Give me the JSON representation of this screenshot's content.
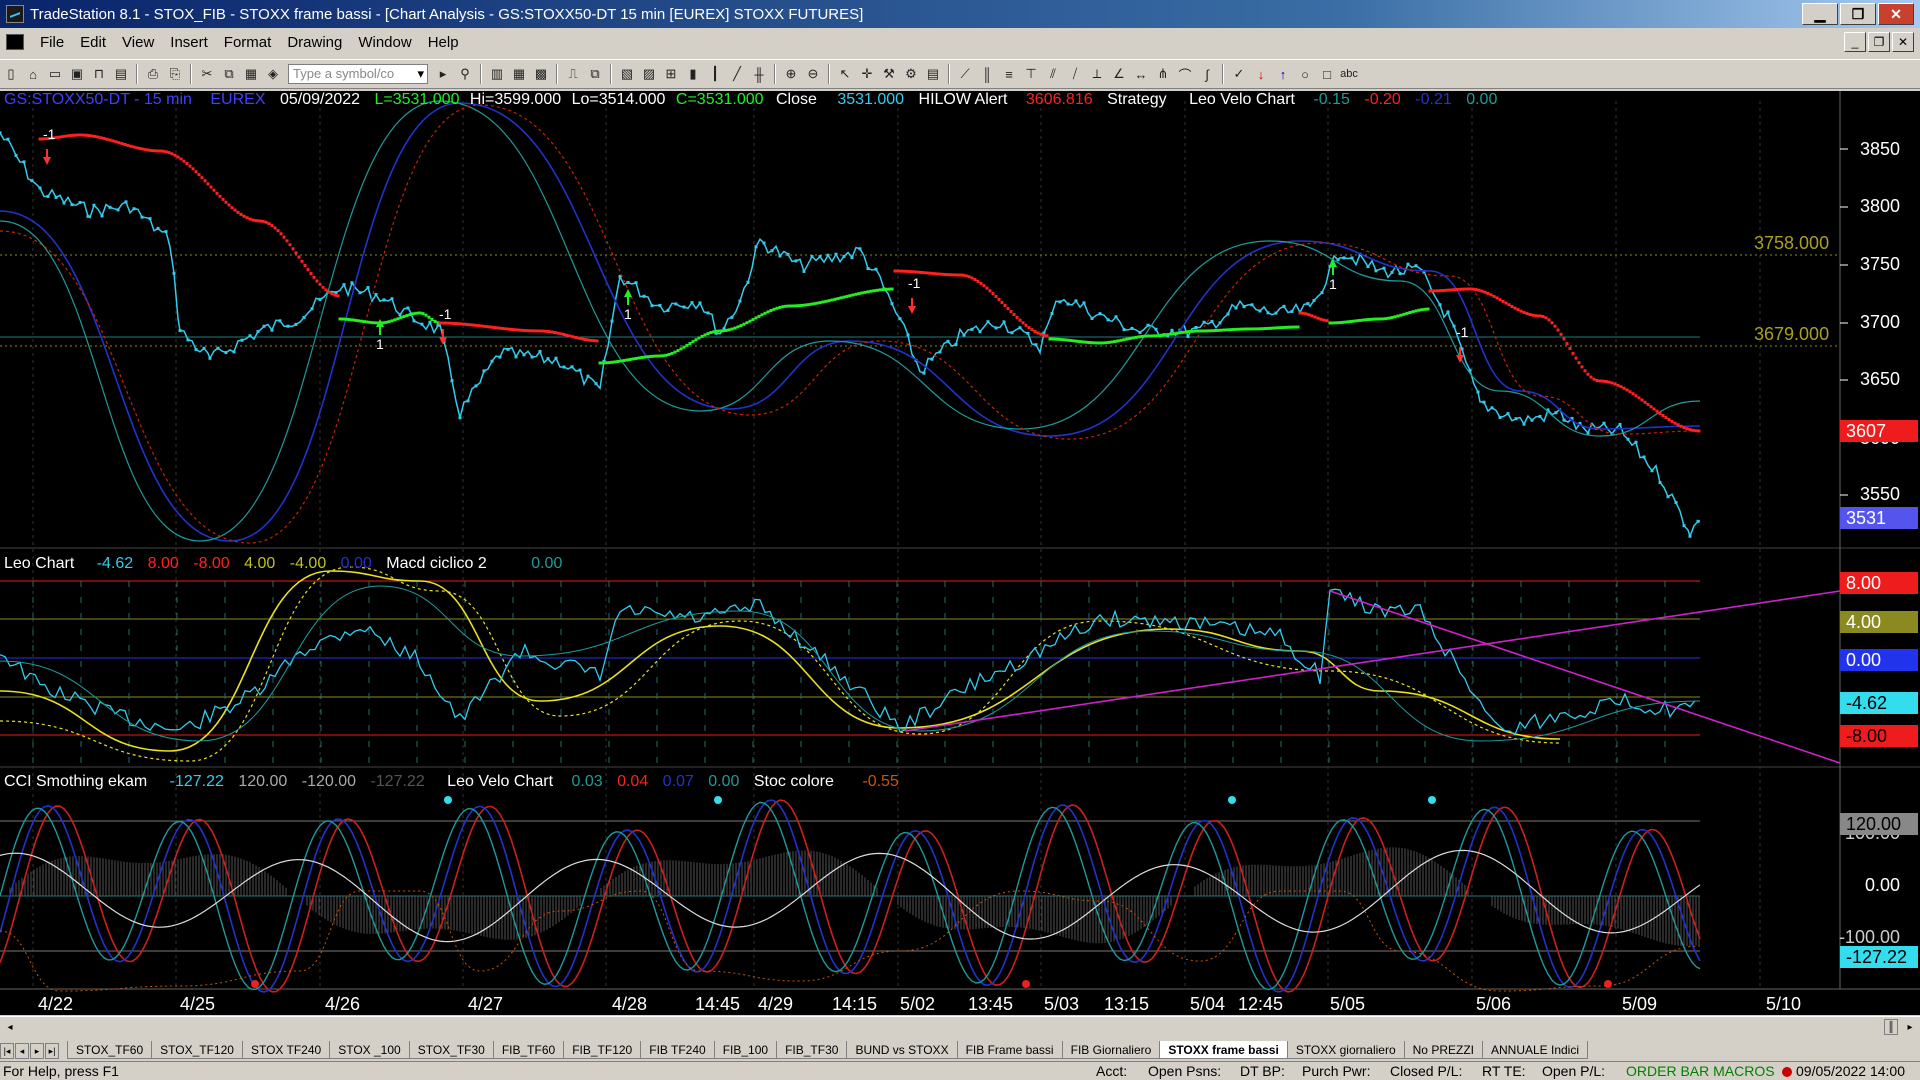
{
  "window": {
    "title": "TradeStation 8.1 - STOX_FIB - STOXX frame bassi - [Chart Analysis - GS:STOXX50-DT  15 min  [EUREX] STOXX FUTURES]"
  },
  "menu": [
    "File",
    "Edit",
    "View",
    "Insert",
    "Format",
    "Drawing",
    "Window",
    "Help"
  ],
  "toolbar": {
    "symbol_placeholder": "Type a symbol/co"
  },
  "price_header": {
    "symbol": "GS:STOXX50-DT - 15 min",
    "exchange": "EUREX",
    "date": "05/09/2022",
    "last": "L=3531.000",
    "hi": "Hi=3599.000",
    "lo": "Lo=3514.000",
    "close": "C=3531.000",
    "close_label": "Close",
    "close_value": "3531.000",
    "hilow_label": "HILOW Alert",
    "hilow_value": "3606.816",
    "strategy_label": "Strategy",
    "velo_label": "Leo Velo Chart",
    "velo_1": "-0.15",
    "velo_2": "-0.20",
    "velo_3": "-0.21",
    "velo_4": "0.00"
  },
  "leo_header": {
    "label": "Leo Chart",
    "v1": "-4.62",
    "v2": "8.00",
    "v3": "-8.00",
    "v4": "4.00",
    "v5": "-4.00",
    "v6": "0.00",
    "macd_label": "Macd ciclico 2",
    "macd_value": "0.00"
  },
  "cci_header": {
    "label": "CCI Smothing ekam",
    "v1": "-127.22",
    "v2": "120.00",
    "v3": "-120.00",
    "v4": "-127.22",
    "velo_label": "Leo Velo Chart",
    "velo_1": "0.03",
    "velo_2": "0.04",
    "velo_3": "0.07",
    "velo_4": "0.00",
    "stoc_label": "Stoc colore",
    "stoc_value": "-0.55"
  },
  "price_axis": {
    "ticks": [
      "3850",
      "3800",
      "3750",
      "3700",
      "3650",
      "3600",
      "3550"
    ],
    "levels": [
      "3758.000",
      "3679.000"
    ],
    "tag_hilow": "3607",
    "tag_last": "3531"
  },
  "leo_axis": {
    "tags": [
      "8.00",
      "4.00",
      "0.00",
      "-4.62",
      "-8.00"
    ]
  },
  "cci_axis": {
    "tags": [
      "120.00",
      "100.00",
      "0.00",
      "-100.00",
      "-127.22"
    ]
  },
  "trade_markers": {
    "short": "-1",
    "long": "1"
  },
  "x_axis": {
    "labels": [
      "4/22",
      "4/25",
      "4/26",
      "4/27",
      "4/28",
      "14:45",
      "4/29",
      "14:15",
      "5/02",
      "13:45",
      "5/03",
      "13:15",
      "5/04",
      "12:45",
      "5/05",
      "5/06",
      "5/09",
      "5/10"
    ]
  },
  "tabs": {
    "items": [
      "STOX_TF60",
      "STOX_TF120",
      "STOX TF240",
      "STOX _100",
      "STOX_TF30",
      "FIB_TF60",
      "FIB_TF120",
      "FIB TF240",
      "FIB_100",
      "FIB_TF30",
      "BUND vs STOXX",
      "FIB Frame bassi",
      "FIB Giornaliero",
      "STOXX frame bassi",
      "STOXX giornaliero",
      "No PREZZI",
      "ANNUALE Indici"
    ],
    "active": "STOXX frame bassi"
  },
  "status": {
    "help": "For Help, press F1",
    "acct": "Acct:",
    "open_psns": "Open Psns:",
    "dt_bp": "DT BP:",
    "purch_pwr": "Purch Pwr:",
    "closed_pl": "Closed P/L:",
    "rt_te": "RT TE:",
    "open_pl": "Open P/L:",
    "macros": "ORDER BAR  MACROS",
    "datetime": "09/05/2022 14:00"
  },
  "colors": {
    "price_line": "#33ccee",
    "hilow_red": "#ff2020",
    "hilow_green": "#22ee22",
    "blue_wave": "#2233cc",
    "teal_wave": "#1f9a9a",
    "dotted_red": "#cc2200",
    "yellow": "#e8e020",
    "magenta": "#cc22cc"
  }
}
